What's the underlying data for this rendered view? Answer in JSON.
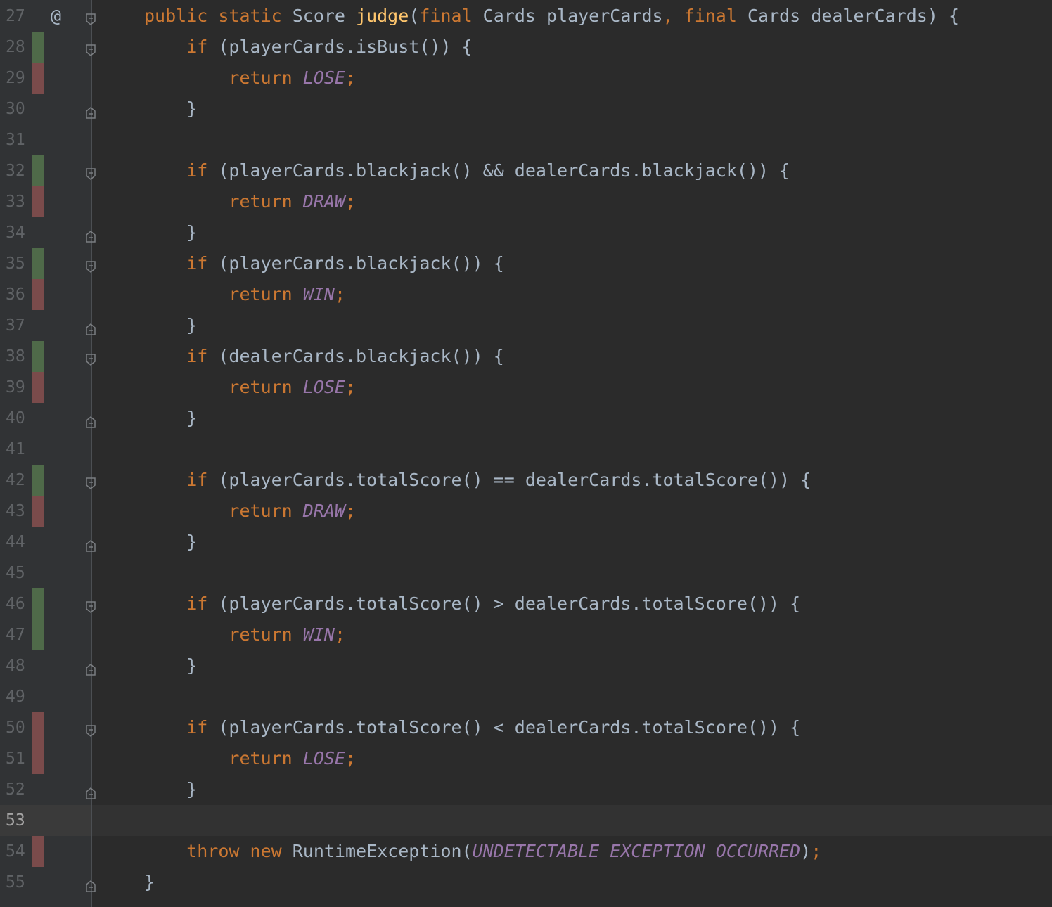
{
  "editor": {
    "current_line": "53",
    "colors": {
      "background": "#2b2b2b",
      "keyword": "#cc7832",
      "method": "#ffc66d",
      "constant": "#9876aa",
      "text": "#a9b7c6",
      "coverage_green": "#4f6a49",
      "coverage_red": "#7a4b4b"
    },
    "gutter_icon": "@",
    "lines": [
      {
        "num": "27",
        "cov": "none",
        "fold": "open",
        "tokens": [
          {
            "t": "kw",
            "v": "public static "
          },
          {
            "t": "pl",
            "v": "Score "
          },
          {
            "t": "fn",
            "v": "judge"
          },
          {
            "t": "pl",
            "v": "("
          },
          {
            "t": "kw",
            "v": "final "
          },
          {
            "t": "pl",
            "v": "Cards playerCards"
          },
          {
            "t": "kw",
            "v": ", final "
          },
          {
            "t": "pl",
            "v": "Cards dealerCards) {"
          }
        ]
      },
      {
        "num": "28",
        "cov": "green",
        "fold": "open",
        "tokens": [
          {
            "t": "pl",
            "v": "    "
          },
          {
            "t": "kw",
            "v": "if "
          },
          {
            "t": "pl",
            "v": "(playerCards.isBust()) {"
          }
        ]
      },
      {
        "num": "29",
        "cov": "red",
        "fold": "none",
        "tokens": [
          {
            "t": "pl",
            "v": "        "
          },
          {
            "t": "kw",
            "v": "return "
          },
          {
            "t": "cst",
            "v": "LOSE"
          },
          {
            "t": "kw",
            "v": ";"
          }
        ]
      },
      {
        "num": "30",
        "cov": "none",
        "fold": "close",
        "tokens": [
          {
            "t": "pl",
            "v": "    }"
          }
        ]
      },
      {
        "num": "31",
        "cov": "none",
        "fold": "none",
        "tokens": []
      },
      {
        "num": "32",
        "cov": "green",
        "fold": "open",
        "tokens": [
          {
            "t": "pl",
            "v": "    "
          },
          {
            "t": "kw",
            "v": "if "
          },
          {
            "t": "pl",
            "v": "(playerCards.blackjack() && dealerCards.blackjack()) {"
          }
        ]
      },
      {
        "num": "33",
        "cov": "red",
        "fold": "none",
        "tokens": [
          {
            "t": "pl",
            "v": "        "
          },
          {
            "t": "kw",
            "v": "return "
          },
          {
            "t": "cst",
            "v": "DRAW"
          },
          {
            "t": "kw",
            "v": ";"
          }
        ]
      },
      {
        "num": "34",
        "cov": "none",
        "fold": "close",
        "tokens": [
          {
            "t": "pl",
            "v": "    }"
          }
        ]
      },
      {
        "num": "35",
        "cov": "green",
        "fold": "open",
        "tokens": [
          {
            "t": "pl",
            "v": "    "
          },
          {
            "t": "kw",
            "v": "if "
          },
          {
            "t": "pl",
            "v": "(playerCards.blackjack()) {"
          }
        ]
      },
      {
        "num": "36",
        "cov": "red",
        "fold": "none",
        "tokens": [
          {
            "t": "pl",
            "v": "        "
          },
          {
            "t": "kw",
            "v": "return "
          },
          {
            "t": "cst",
            "v": "WIN"
          },
          {
            "t": "kw",
            "v": ";"
          }
        ]
      },
      {
        "num": "37",
        "cov": "none",
        "fold": "close",
        "tokens": [
          {
            "t": "pl",
            "v": "    }"
          }
        ]
      },
      {
        "num": "38",
        "cov": "green",
        "fold": "open",
        "tokens": [
          {
            "t": "pl",
            "v": "    "
          },
          {
            "t": "kw",
            "v": "if "
          },
          {
            "t": "pl",
            "v": "(dealerCards.blackjack()) {"
          }
        ]
      },
      {
        "num": "39",
        "cov": "red",
        "fold": "none",
        "tokens": [
          {
            "t": "pl",
            "v": "        "
          },
          {
            "t": "kw",
            "v": "return "
          },
          {
            "t": "cst",
            "v": "LOSE"
          },
          {
            "t": "kw",
            "v": ";"
          }
        ]
      },
      {
        "num": "40",
        "cov": "none",
        "fold": "close",
        "tokens": [
          {
            "t": "pl",
            "v": "    }"
          }
        ]
      },
      {
        "num": "41",
        "cov": "none",
        "fold": "none",
        "tokens": []
      },
      {
        "num": "42",
        "cov": "green",
        "fold": "open",
        "tokens": [
          {
            "t": "pl",
            "v": "    "
          },
          {
            "t": "kw",
            "v": "if "
          },
          {
            "t": "pl",
            "v": "(playerCards.totalScore() == dealerCards.totalScore()) {"
          }
        ]
      },
      {
        "num": "43",
        "cov": "red",
        "fold": "none",
        "tokens": [
          {
            "t": "pl",
            "v": "        "
          },
          {
            "t": "kw",
            "v": "return "
          },
          {
            "t": "cst",
            "v": "DRAW"
          },
          {
            "t": "kw",
            "v": ";"
          }
        ]
      },
      {
        "num": "44",
        "cov": "none",
        "fold": "close",
        "tokens": [
          {
            "t": "pl",
            "v": "    }"
          }
        ]
      },
      {
        "num": "45",
        "cov": "none",
        "fold": "none",
        "tokens": []
      },
      {
        "num": "46",
        "cov": "green",
        "fold": "open",
        "tokens": [
          {
            "t": "pl",
            "v": "    "
          },
          {
            "t": "kw",
            "v": "if "
          },
          {
            "t": "pl",
            "v": "(playerCards.totalScore() > dealerCards.totalScore()) {"
          }
        ]
      },
      {
        "num": "47",
        "cov": "green",
        "fold": "none",
        "tokens": [
          {
            "t": "pl",
            "v": "        "
          },
          {
            "t": "kw",
            "v": "return "
          },
          {
            "t": "cst",
            "v": "WIN"
          },
          {
            "t": "kw",
            "v": ";"
          }
        ]
      },
      {
        "num": "48",
        "cov": "none",
        "fold": "close",
        "tokens": [
          {
            "t": "pl",
            "v": "    }"
          }
        ]
      },
      {
        "num": "49",
        "cov": "none",
        "fold": "none",
        "tokens": []
      },
      {
        "num": "50",
        "cov": "red",
        "fold": "open",
        "tokens": [
          {
            "t": "pl",
            "v": "    "
          },
          {
            "t": "kw",
            "v": "if "
          },
          {
            "t": "pl",
            "v": "(playerCards.totalScore() < dealerCards.totalScore()) {"
          }
        ]
      },
      {
        "num": "51",
        "cov": "red",
        "fold": "none",
        "tokens": [
          {
            "t": "pl",
            "v": "        "
          },
          {
            "t": "kw",
            "v": "return "
          },
          {
            "t": "cst",
            "v": "LOSE"
          },
          {
            "t": "kw",
            "v": ";"
          }
        ]
      },
      {
        "num": "52",
        "cov": "none",
        "fold": "close",
        "tokens": [
          {
            "t": "pl",
            "v": "    }"
          }
        ]
      },
      {
        "num": "53",
        "cov": "none",
        "fold": "none",
        "tokens": []
      },
      {
        "num": "54",
        "cov": "red",
        "fold": "none",
        "tokens": [
          {
            "t": "pl",
            "v": "    "
          },
          {
            "t": "kw",
            "v": "throw new "
          },
          {
            "t": "pl",
            "v": "RuntimeException("
          },
          {
            "t": "cst",
            "v": "UNDETECTABLE_EXCEPTION_OCCURRED"
          },
          {
            "t": "pl",
            "v": ")"
          },
          {
            "t": "kw",
            "v": ";"
          }
        ]
      },
      {
        "num": "55",
        "cov": "none",
        "fold": "close",
        "tokens": [
          {
            "t": "pl",
            "v": "}"
          }
        ]
      }
    ]
  }
}
